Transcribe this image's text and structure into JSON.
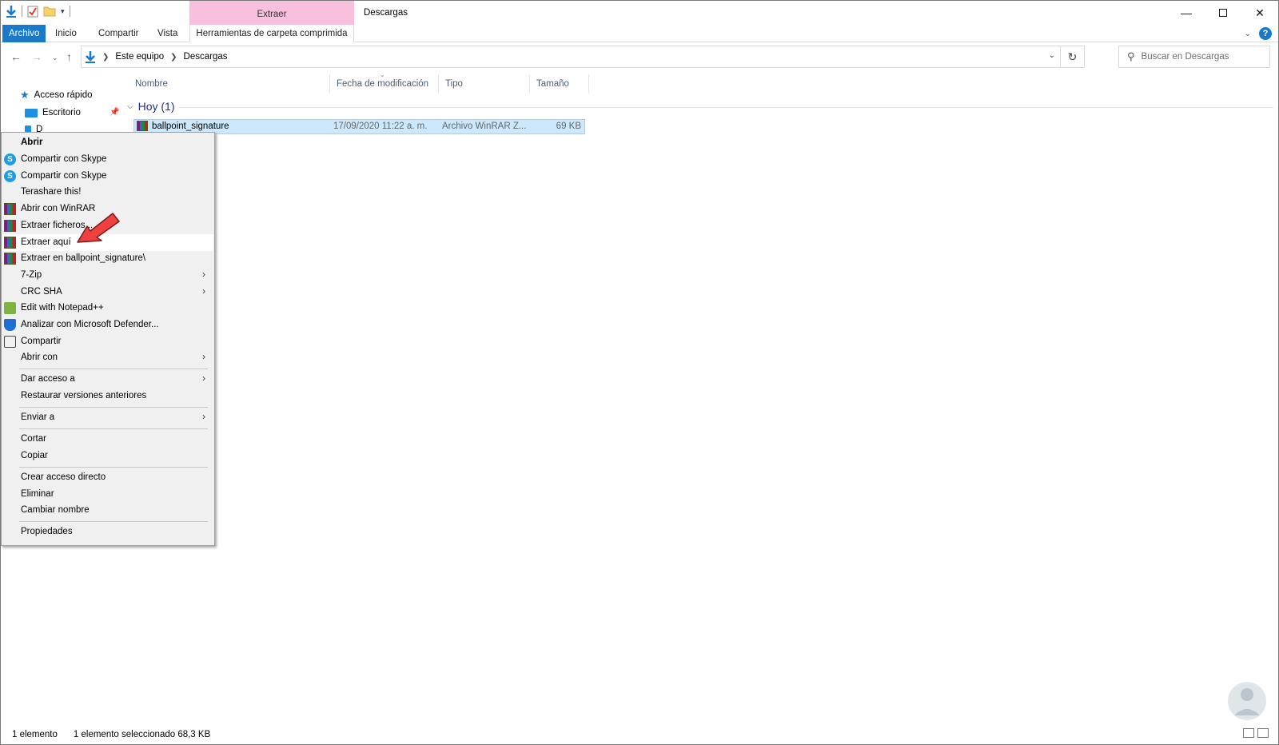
{
  "window": {
    "title": "Descargas",
    "context_tab_header": "Extraer"
  },
  "ribbon": {
    "tabs": [
      "Archivo",
      "Inicio",
      "Compartir",
      "Vista"
    ],
    "context_tab": "Herramientas de carpeta comprimida",
    "help": "?"
  },
  "address": {
    "crumbs": [
      "Este equipo",
      "Descargas"
    ],
    "search_placeholder": "Buscar en Descargas"
  },
  "navpane": {
    "items": [
      "Acceso rápido",
      "Escritorio",
      "D"
    ]
  },
  "filelist": {
    "columns": [
      "Nombre",
      "Fecha de modificación",
      "Tipo",
      "Tamaño"
    ],
    "group": "Hoy (1)",
    "rows": [
      {
        "name": "ballpoint_signature",
        "date": "17/09/2020 11:22 a. m.",
        "type": "Archivo WinRAR Z...",
        "size": "69 KB"
      }
    ]
  },
  "context_menu": {
    "items": [
      "Abrir",
      "Compartir con Skype",
      "Compartir con Skype",
      "Terashare this!",
      "Abrir con WinRAR",
      "Extraer ficheros...",
      "Extraer aquí",
      "Extraer en ballpoint_signature\\",
      "7-Zip",
      "CRC SHA",
      "Edit with Notepad++",
      "Analizar con Microsoft Defender...",
      "Compartir",
      "Abrir con",
      "Dar acceso a",
      "Restaurar versiones anteriores",
      "Enviar a",
      "Cortar",
      "Copiar",
      "Crear acceso directo",
      "Eliminar",
      "Cambiar nombre",
      "Propiedades"
    ],
    "highlighted": "Extraer aquí"
  },
  "status": {
    "count": "1 elemento",
    "selection": "1 elemento seleccionado  68,3 KB"
  },
  "colors": {
    "accent": "#1979ca",
    "context_tab": "#f8c0dc",
    "selection": "#cce8ff",
    "arrow": "#f04040"
  }
}
